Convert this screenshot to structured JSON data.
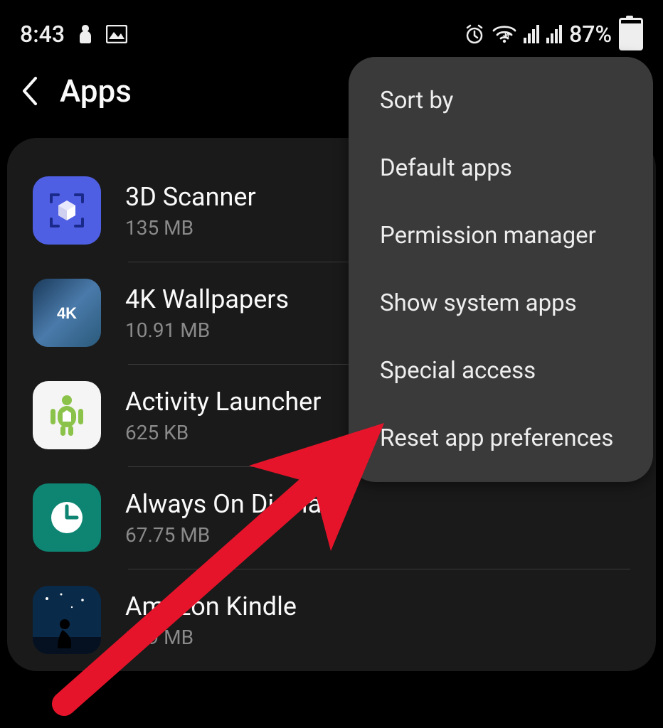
{
  "status": {
    "time": "8:43",
    "battery_pct": "87%"
  },
  "header": {
    "title": "Apps"
  },
  "apps": [
    {
      "name": "3D Scanner",
      "size": "135 MB"
    },
    {
      "name": "4K Wallpapers",
      "size": "10.91 MB"
    },
    {
      "name": "Activity Launcher",
      "size": "625 KB"
    },
    {
      "name": "Always On Display",
      "size": "67.75 MB"
    },
    {
      "name": "Amazon Kindle",
      "size": "199 MB"
    }
  ],
  "menu": {
    "items": [
      "Sort by",
      "Default apps",
      "Permission manager",
      "Show system apps",
      "Special access",
      "Reset app preferences"
    ]
  }
}
